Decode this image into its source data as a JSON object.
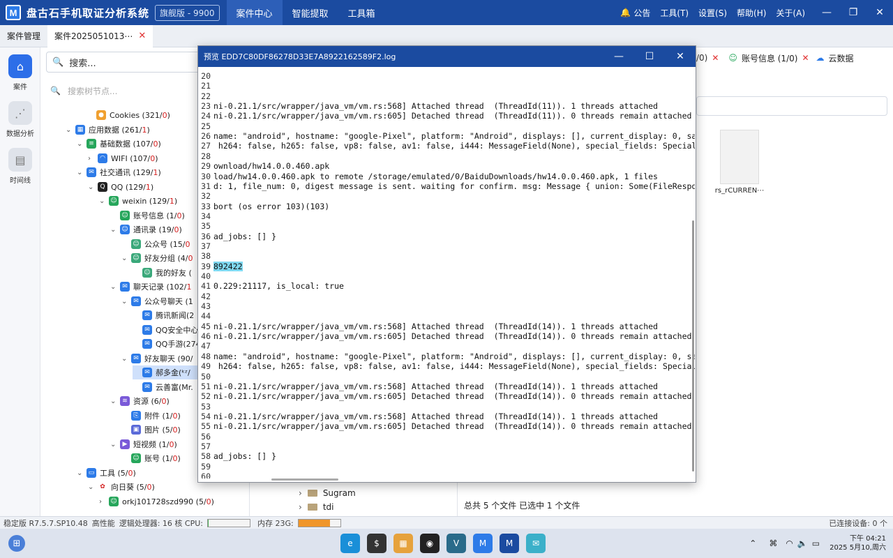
{
  "app": {
    "logo_letter": "M",
    "title": "盘古石手机取证分析系统",
    "edition": "旗舰版 - 9900",
    "nav": [
      "案件中心",
      "智能提取",
      "工具箱"
    ],
    "menu": [
      "公告",
      "工具(T)",
      "设置(S)",
      "帮助(H)",
      "关于(A)"
    ]
  },
  "tabs": [
    {
      "label": "案件管理"
    },
    {
      "label": "案件2025051013⋯"
    }
  ],
  "leftbar": [
    {
      "label": "案件"
    },
    {
      "label": "数据分析"
    },
    {
      "label": "时间线"
    }
  ],
  "search": {
    "placeholder": "搜索..."
  },
  "tree_filter": {
    "placeholder": "搜索树节点..."
  },
  "tree": [
    {
      "t": "Cookies (321/",
      "r": "0",
      "c": ")"
    },
    {
      "t": "应用数据 (261/",
      "r": "1",
      "c": ")"
    },
    {
      "t": "基础数据 (107/",
      "r": "0",
      "c": ")"
    },
    {
      "t": "WIFI (107/",
      "r": "0",
      "c": ")"
    },
    {
      "t": "社交通讯 (129/",
      "r": "1",
      "c": ")"
    },
    {
      "t": "QQ (129/",
      "r": "1",
      "c": ")"
    },
    {
      "t": "weixin (129/",
      "r": "1",
      "c": ")"
    },
    {
      "t": "账号信息 (1/",
      "r": "0",
      "c": ")"
    },
    {
      "t": "通讯录 (19/",
      "r": "0",
      "c": ")"
    },
    {
      "t": "公众号 (15/",
      "r": "0",
      "c": ""
    },
    {
      "t": "好友分组 (4/",
      "r": "0",
      "c": ""
    },
    {
      "t": "我的好友 (",
      "r": "",
      "c": ""
    },
    {
      "t": "聊天记录 (102/",
      "r": "1",
      "c": ""
    },
    {
      "t": "公众号聊天 (1",
      "r": "",
      "c": ""
    },
    {
      "t": "腾讯新闻(2",
      "r": "",
      "c": ""
    },
    {
      "t": "QQ安全中心",
      "r": "",
      "c": ""
    },
    {
      "t": "QQ手游(274",
      "r": "",
      "c": ""
    },
    {
      "t": "好友聊天 (90/",
      "r": "",
      "c": ""
    },
    {
      "t": "郝多金(ᵏᶻ/",
      "r": "",
      "c": ""
    },
    {
      "t": "云善富(Mr.",
      "r": "",
      "c": ""
    },
    {
      "t": "资源 (6/",
      "r": "0",
      "c": ")"
    },
    {
      "t": "附件 (1/",
      "r": "0",
      "c": ")"
    },
    {
      "t": "图片 (5/",
      "r": "0",
      "c": ")"
    },
    {
      "t": "短视频 (1/",
      "r": "0",
      "c": ")"
    },
    {
      "t": "账号 (1/",
      "r": "0",
      "c": ")"
    },
    {
      "t": "工具 (5/",
      "r": "0",
      "c": ")"
    },
    {
      "t": "向日葵 (5/",
      "r": "0",
      "c": ")"
    },
    {
      "t": "orkj101728szd990 (5/",
      "r": "0",
      "c": ")"
    }
  ],
  "right_tabs": [
    "/0)",
    "✕",
    "账号信息 (1/0)",
    "✕",
    "云数据"
  ],
  "file": {
    "name": "rs_rCURREN⋯"
  },
  "file_tree": [
    "Sugram",
    "tdi"
  ],
  "file_status": "总共 5 个文件   已选中 1 个文件",
  "statusbar": {
    "version": "稳定版 R7.5.7.SP10.48",
    "perf": "高性能",
    "cpu_text": "逻辑处理器: 16 核 CPU:",
    "cpu_fraction": 0.02,
    "mem_text": "内存 23G:",
    "mem_fraction": 0.75,
    "devices": "已连接设备: 0 个"
  },
  "clock": {
    "time": "下午 04:21",
    "date": "2025 5月10,周六"
  },
  "modal": {
    "title": "预览 EDD7C80DF86278D33E7A8922162589F2.log",
    "lines": [
      {
        "n": "20",
        "t": ""
      },
      {
        "n": "21",
        "t": ""
      },
      {
        "n": "22",
        "t": ""
      },
      {
        "n": "23",
        "t": "ni-0.21.1/src/wrapper/java_vm/vm.rs:568] Attached thread  (ThreadId(11)). 1 threads attached"
      },
      {
        "n": "24",
        "t": "ni-0.21.1/src/wrapper/java_vm/vm.rs:605] Detached thread  (ThreadId(11)). 0 threads remain attached"
      },
      {
        "n": "25",
        "t": ""
      },
      {
        "n": "26",
        "t": "name: \"android\", hostname: \"google-Pixel\", platform: \"Android\", displays: [], current_display: 0, sas_e"
      },
      {
        "n": "27",
        "t": " h264: false, h265: false, vp8: false, av1: false, i444: MessageField(None), special_fields: SpecialFie"
      },
      {
        "n": "28",
        "t": ""
      },
      {
        "n": "29",
        "t": "ownload/hw14.0.0.460.apk"
      },
      {
        "n": "30",
        "t": "load/hw14.0.0.460.apk to remote /storage/emulated/0/BaiduDownloads/hw14.0.0.460.apk, 1 files"
      },
      {
        "n": "31",
        "t": "d: 1, file_num: 0, digest message is sent. waiting for confirm. msg: Message { union: Some(FileResponse"
      },
      {
        "n": "32",
        "t": ""
      },
      {
        "n": "33",
        "t": "bort (os error 103)(103)"
      },
      {
        "n": "34",
        "t": ""
      },
      {
        "n": "35",
        "t": ""
      },
      {
        "n": "36",
        "t": "ad_jobs: [] }"
      },
      {
        "n": "37",
        "t": ""
      },
      {
        "n": "38",
        "t": ""
      },
      {
        "n": "39",
        "t": "892422",
        "hl": true
      },
      {
        "n": "40",
        "t": ""
      },
      {
        "n": "41",
        "t": "0.229:21117, is_local: true"
      },
      {
        "n": "42",
        "t": ""
      },
      {
        "n": "43",
        "t": ""
      },
      {
        "n": "44",
        "t": ""
      },
      {
        "n": "45",
        "t": "ni-0.21.1/src/wrapper/java_vm/vm.rs:568] Attached thread  (ThreadId(14)). 1 threads attached"
      },
      {
        "n": "46",
        "t": "ni-0.21.1/src/wrapper/java_vm/vm.rs:605] Detached thread  (ThreadId(14)). 0 threads remain attached"
      },
      {
        "n": "47",
        "t": ""
      },
      {
        "n": "48",
        "t": "name: \"android\", hostname: \"google-Pixel\", platform: \"Android\", displays: [], current_display: 0, sas_e"
      },
      {
        "n": "49",
        "t": " h264: false, h265: false, vp8: false, av1: false, i444: MessageField(None), special_fields: SpecialFie"
      },
      {
        "n": "50",
        "t": ""
      },
      {
        "n": "51",
        "t": "ni-0.21.1/src/wrapper/java_vm/vm.rs:568] Attached thread  (ThreadId(14)). 1 threads attached"
      },
      {
        "n": "52",
        "t": "ni-0.21.1/src/wrapper/java_vm/vm.rs:605] Detached thread  (ThreadId(14)). 0 threads remain attached"
      },
      {
        "n": "53",
        "t": ""
      },
      {
        "n": "54",
        "t": "ni-0.21.1/src/wrapper/java_vm/vm.rs:568] Attached thread  (ThreadId(14)). 1 threads attached"
      },
      {
        "n": "55",
        "t": "ni-0.21.1/src/wrapper/java_vm/vm.rs:605] Detached thread  (ThreadId(14)). 0 threads remain attached"
      },
      {
        "n": "56",
        "t": ""
      },
      {
        "n": "57",
        "t": ""
      },
      {
        "n": "58",
        "t": "ad_jobs: [] }"
      },
      {
        "n": "59",
        "t": ""
      },
      {
        "n": "60",
        "t": ""
      }
    ]
  },
  "colors": {
    "titlebar": "#1b4ba0",
    "accent": "#2d6ee8",
    "red": "#d42020",
    "highlight": "#7fd8f0"
  }
}
